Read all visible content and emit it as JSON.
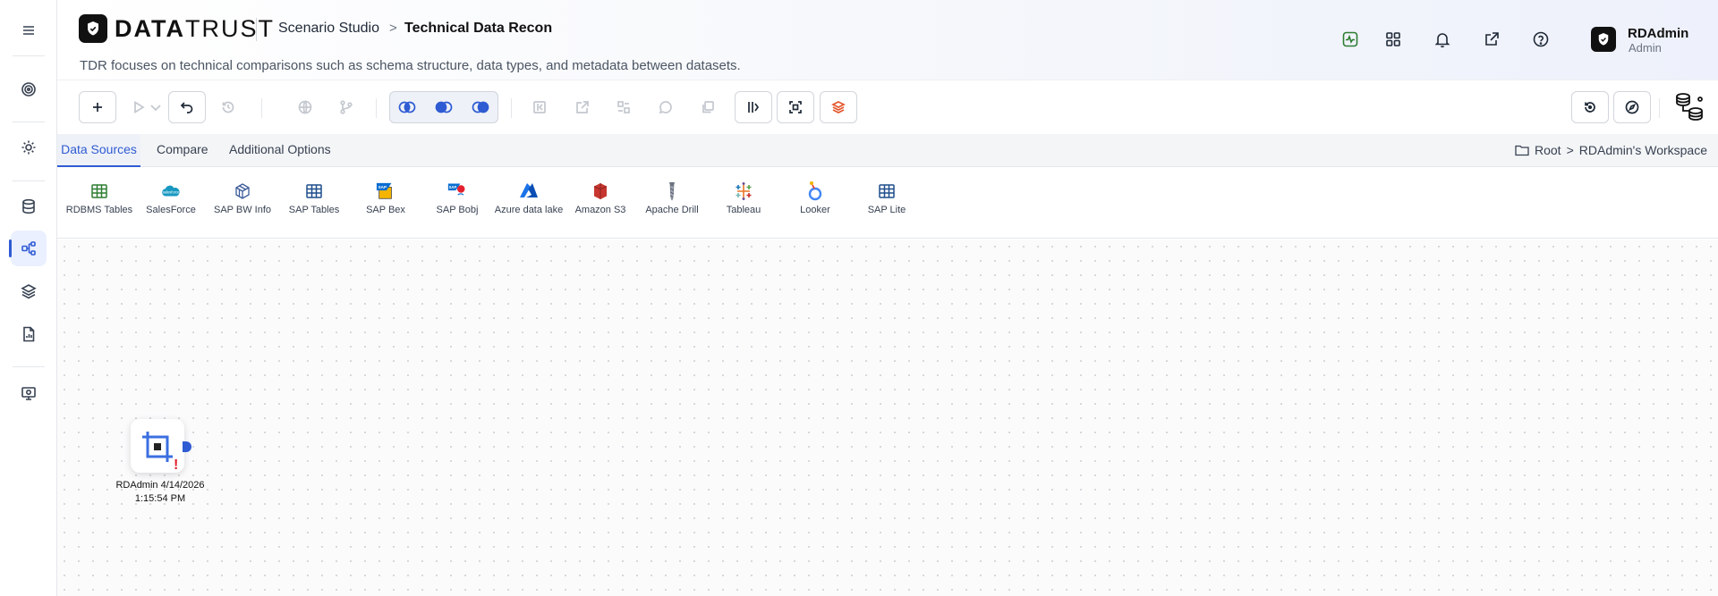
{
  "header": {
    "logo_strong": "DATA",
    "logo_light": "TRUST",
    "breadcrumb_root": "Scenario Studio",
    "breadcrumb_sep": ">",
    "page_title": "Technical Data Recon",
    "subtitle": "TDR focuses on technical comparisons such as schema structure, data types, and metadata between datasets.",
    "icons": [
      "activity-icon",
      "grid-icon",
      "bell-icon",
      "external-link-icon",
      "help-icon"
    ],
    "user": {
      "name": "RDAdmin",
      "role": "Admin"
    }
  },
  "sidebar": {
    "items": [
      "menu-icon",
      "target-icon",
      "settings-icon",
      "database-icon",
      "workflow-icon",
      "layers-icon",
      "report-icon",
      "monitor-icon"
    ],
    "active": "workflow-icon"
  },
  "tabs": {
    "items": [
      "Data Sources",
      "Compare",
      "Additional Options"
    ],
    "active": "Data Sources",
    "workspace": {
      "root": "Root",
      "sep": ">",
      "name": "RDAdmin's Workspace"
    }
  },
  "sources": [
    {
      "label": "RDBMS Tables",
      "icon": "table-icon",
      "color": "#2e7d32"
    },
    {
      "label": "SalesForce",
      "icon": "salesforce-icon",
      "color": "#1798c1"
    },
    {
      "label": "SAP BW Info",
      "icon": "cube-icon",
      "color": "#3b5b9a"
    },
    {
      "label": "SAP Tables",
      "icon": "table-icon",
      "color": "#1f4e8c"
    },
    {
      "label": "SAP Bex",
      "icon": "sap-icon",
      "color": "#0a6ed1"
    },
    {
      "label": "SAP Bobj",
      "icon": "sap-bobj-icon",
      "color": "#e5202e"
    },
    {
      "label": "Azure data lake",
      "icon": "azure-icon",
      "color": "#1b73e8"
    },
    {
      "label": "Amazon S3",
      "icon": "s3-icon",
      "color": "#c7372f"
    },
    {
      "label": "Apache Drill",
      "icon": "drill-icon",
      "color": "#6b7280"
    },
    {
      "label": "Tableau",
      "icon": "tableau-icon",
      "color": "#e97627"
    },
    {
      "label": "Looker",
      "icon": "looker-icon",
      "color": "#4285f4"
    },
    {
      "label": "SAP Lite",
      "icon": "table-icon",
      "color": "#1f4e8c"
    }
  ],
  "canvas": {
    "node_label": "RDAdmin 4/14/2026 1:15:54 PM",
    "node_alert": "!"
  },
  "colors": {
    "accent": "#2f5bd3",
    "alert": "#e11d2a"
  }
}
